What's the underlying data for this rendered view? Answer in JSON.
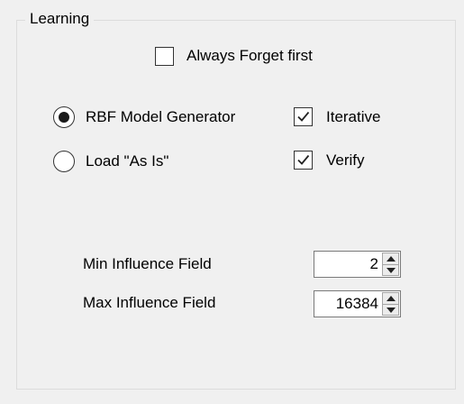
{
  "group": {
    "title": "Learning"
  },
  "always_forget": {
    "label": "Always Forget first",
    "checked": false
  },
  "mode": {
    "options": [
      {
        "label": "RBF Model Generator",
        "selected": true
      },
      {
        "label": "Load \"As Is\"",
        "selected": false
      }
    ]
  },
  "iterative": {
    "label": "Iterative",
    "checked": true
  },
  "verify": {
    "label": "Verify",
    "checked": true
  },
  "min_field": {
    "label": "Min Influence Field",
    "value": "2"
  },
  "max_field": {
    "label": "Max Influence Field",
    "value": "16384"
  }
}
